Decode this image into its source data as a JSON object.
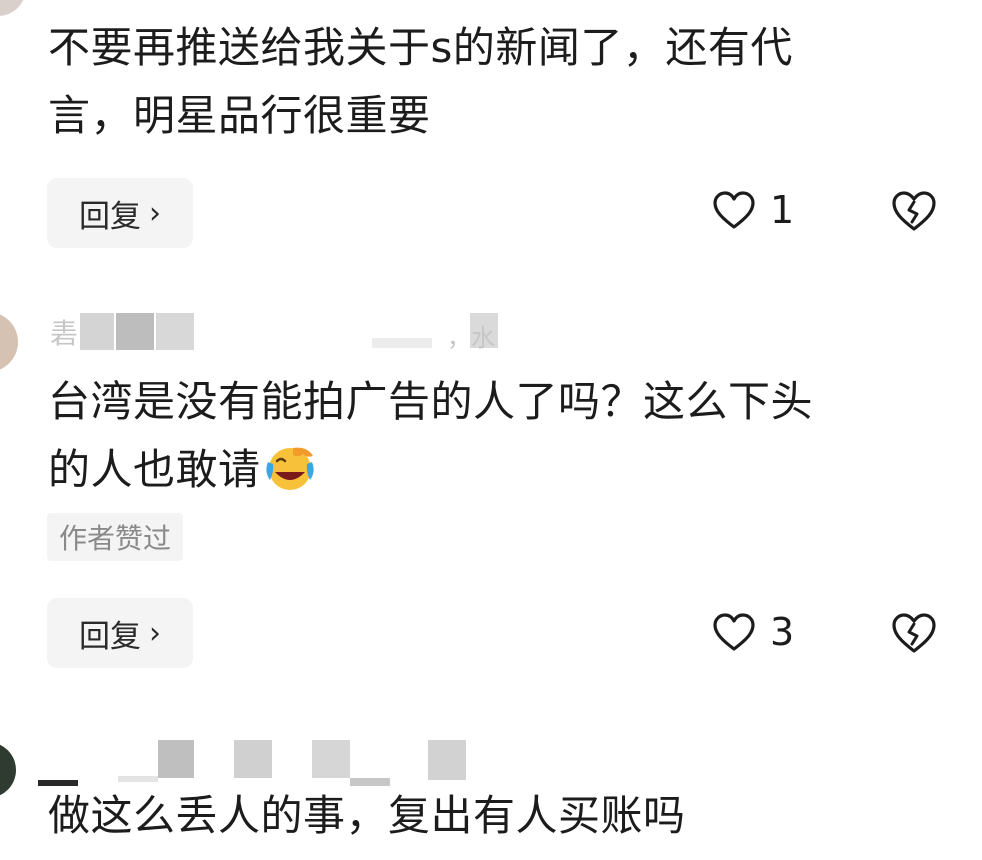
{
  "comments": [
    {
      "text_line1": "不要再推送给我关于s的新闻了，还有代",
      "text_line2": "言，明星品行很重要",
      "reply_label": "回复",
      "like_count": "1"
    },
    {
      "username_fragment_start": "砉",
      "username_fragment_end": "，水",
      "text_line1": "台湾是没有能拍广告的人了吗？这么下头",
      "text_line2": "的人也敢请",
      "badge": "作者赞过",
      "reply_label": "回复",
      "like_count": "3"
    },
    {
      "text_line1": "做这么丢人的事，复出有人买账吗"
    }
  ],
  "icons": {
    "reply_chevron": "chevron-right-icon",
    "like": "heart-outline-icon",
    "dislike": "broken-heart-icon",
    "emoji": "laughing-crying-emoji"
  }
}
